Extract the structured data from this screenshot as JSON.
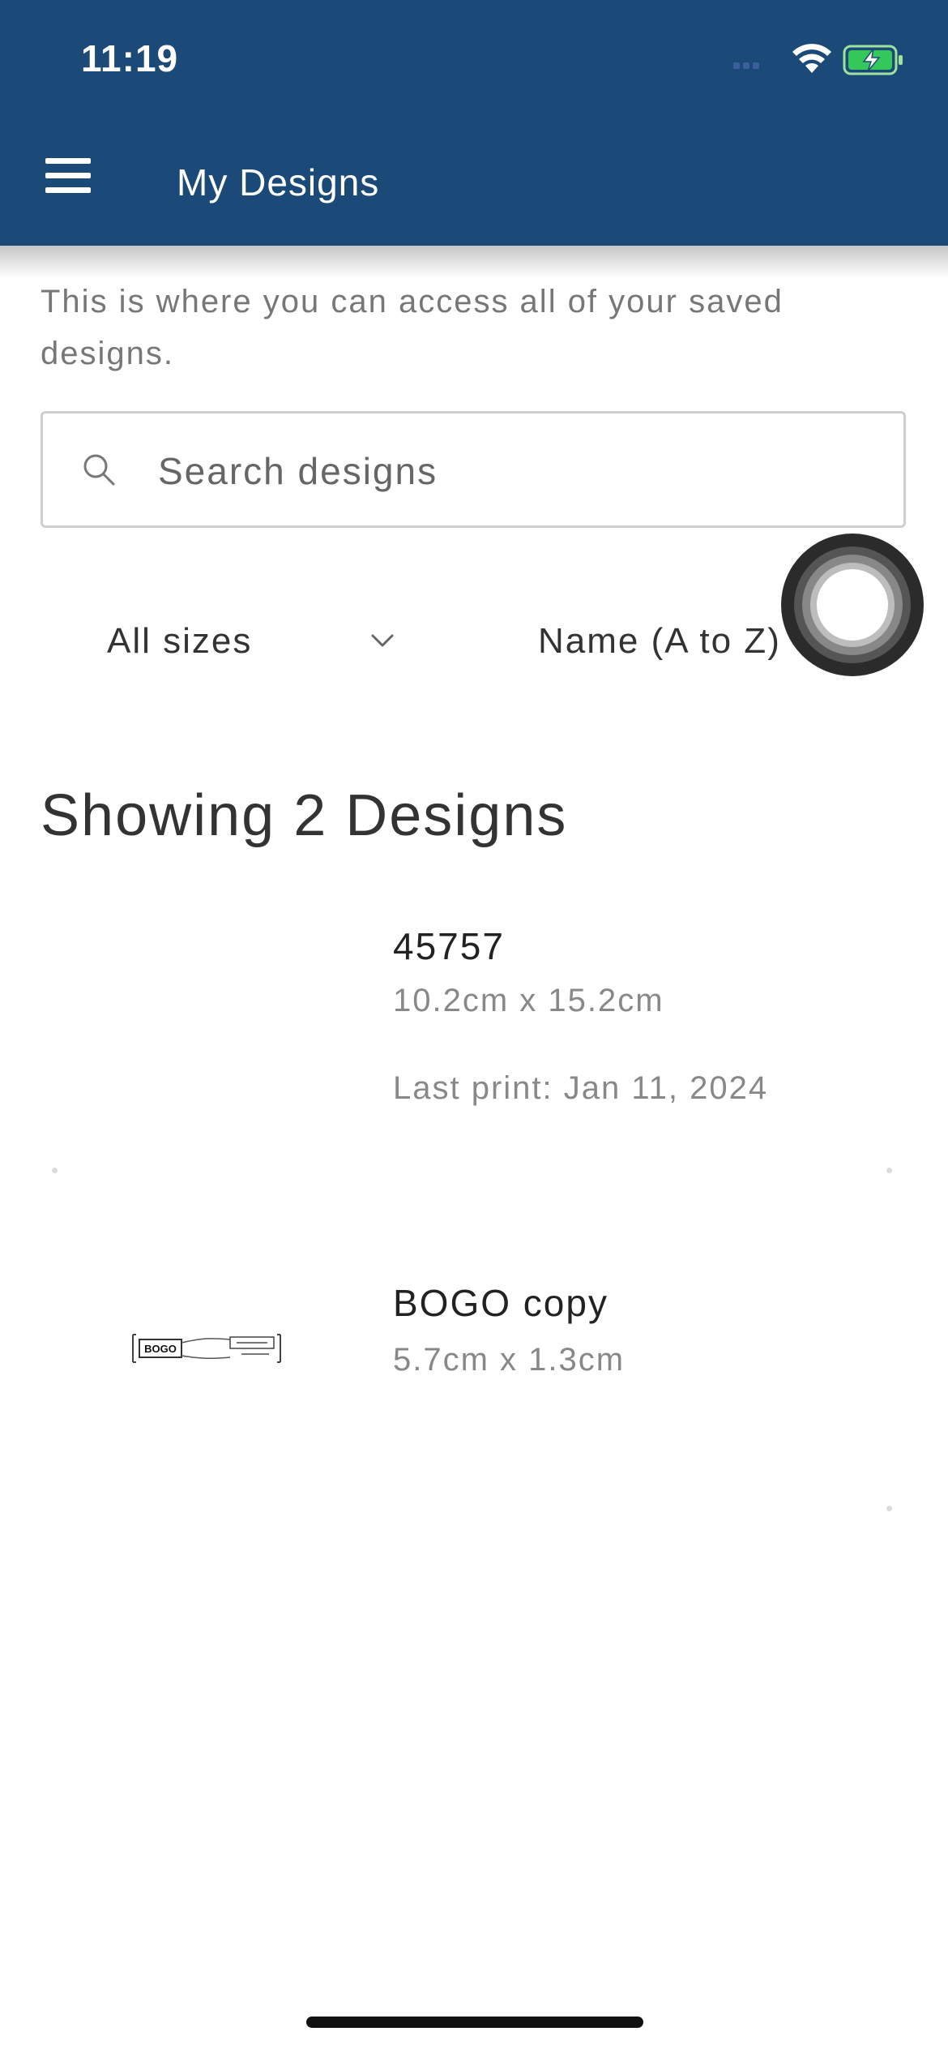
{
  "status_bar": {
    "time": "11:19"
  },
  "header": {
    "title": "My Designs",
    "background_color": "#1b4a78"
  },
  "intro": {
    "text": "This is where you can access all of your saved designs."
  },
  "search": {
    "placeholder": "Search designs",
    "value": ""
  },
  "filters": {
    "size_label": "All sizes",
    "sort_label": "Name (A to Z)"
  },
  "results": {
    "heading": "Showing 2 Designs"
  },
  "designs": [
    {
      "name": "45757",
      "size": "10.2cm x 15.2cm",
      "last_print": "Last print: Jan 11, 2024"
    },
    {
      "name": "BOGO copy",
      "size": "5.7cm x 1.3cm",
      "thumbnail_text": "BOGO"
    }
  ],
  "icons": {
    "menu": "menu-icon",
    "search": "search-icon",
    "dropdown": "chevron-down-icon",
    "wifi": "wifi-icon",
    "battery": "battery-charging-icon"
  }
}
